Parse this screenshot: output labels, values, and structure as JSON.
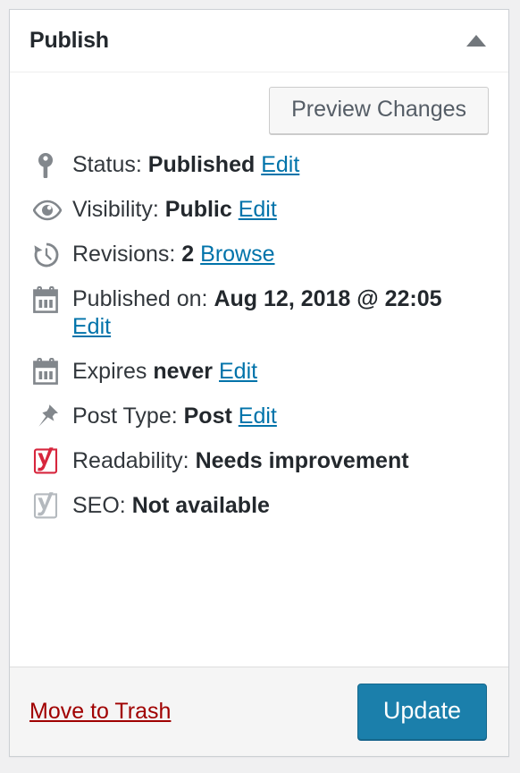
{
  "panel": {
    "title": "Publish",
    "toggle_icon": "triangle-up-icon"
  },
  "preview": {
    "label": "Preview Changes"
  },
  "rows": [
    {
      "icon": "post-status-pin-icon",
      "label": "Status:",
      "value": "Published",
      "action": "Edit",
      "wrap_action": false
    },
    {
      "icon": "eye-icon",
      "label": "Visibility:",
      "value": "Public",
      "action": "Edit",
      "wrap_action": false
    },
    {
      "icon": "backup-clock-icon",
      "label": "Revisions:",
      "value": "2",
      "action": "Browse",
      "wrap_action": false
    },
    {
      "icon": "calendar-icon",
      "label": "Published on:",
      "value": "Aug 12, 2018 @ 22:05",
      "action": "Edit",
      "wrap_action": true
    },
    {
      "icon": "calendar-icon",
      "label": "Expires",
      "value": "never",
      "action": "Edit",
      "wrap_action": false
    },
    {
      "icon": "pushpin-icon",
      "label": "Post Type:",
      "value": "Post",
      "action": "Edit",
      "wrap_action": false
    },
    {
      "icon": "yoast-logo-red-icon",
      "label": "Readability:",
      "value": "Needs improvement",
      "action": "",
      "wrap_action": false
    },
    {
      "icon": "yoast-logo-grey-icon",
      "label": "SEO:",
      "value": "Not available",
      "action": "",
      "wrap_action": false
    }
  ],
  "footer": {
    "trash_label": "Move to Trash",
    "update_label": "Update"
  },
  "colors": {
    "link_blue": "#0073aa",
    "trash_red": "#a00000",
    "primary_button": "#1b7fab",
    "icon_grey": "#82878c",
    "yoast_red": "#d7263d",
    "panel_border": "#ccd0d4",
    "footer_bg": "#f5f5f5",
    "page_bg": "#f0f0f1"
  }
}
